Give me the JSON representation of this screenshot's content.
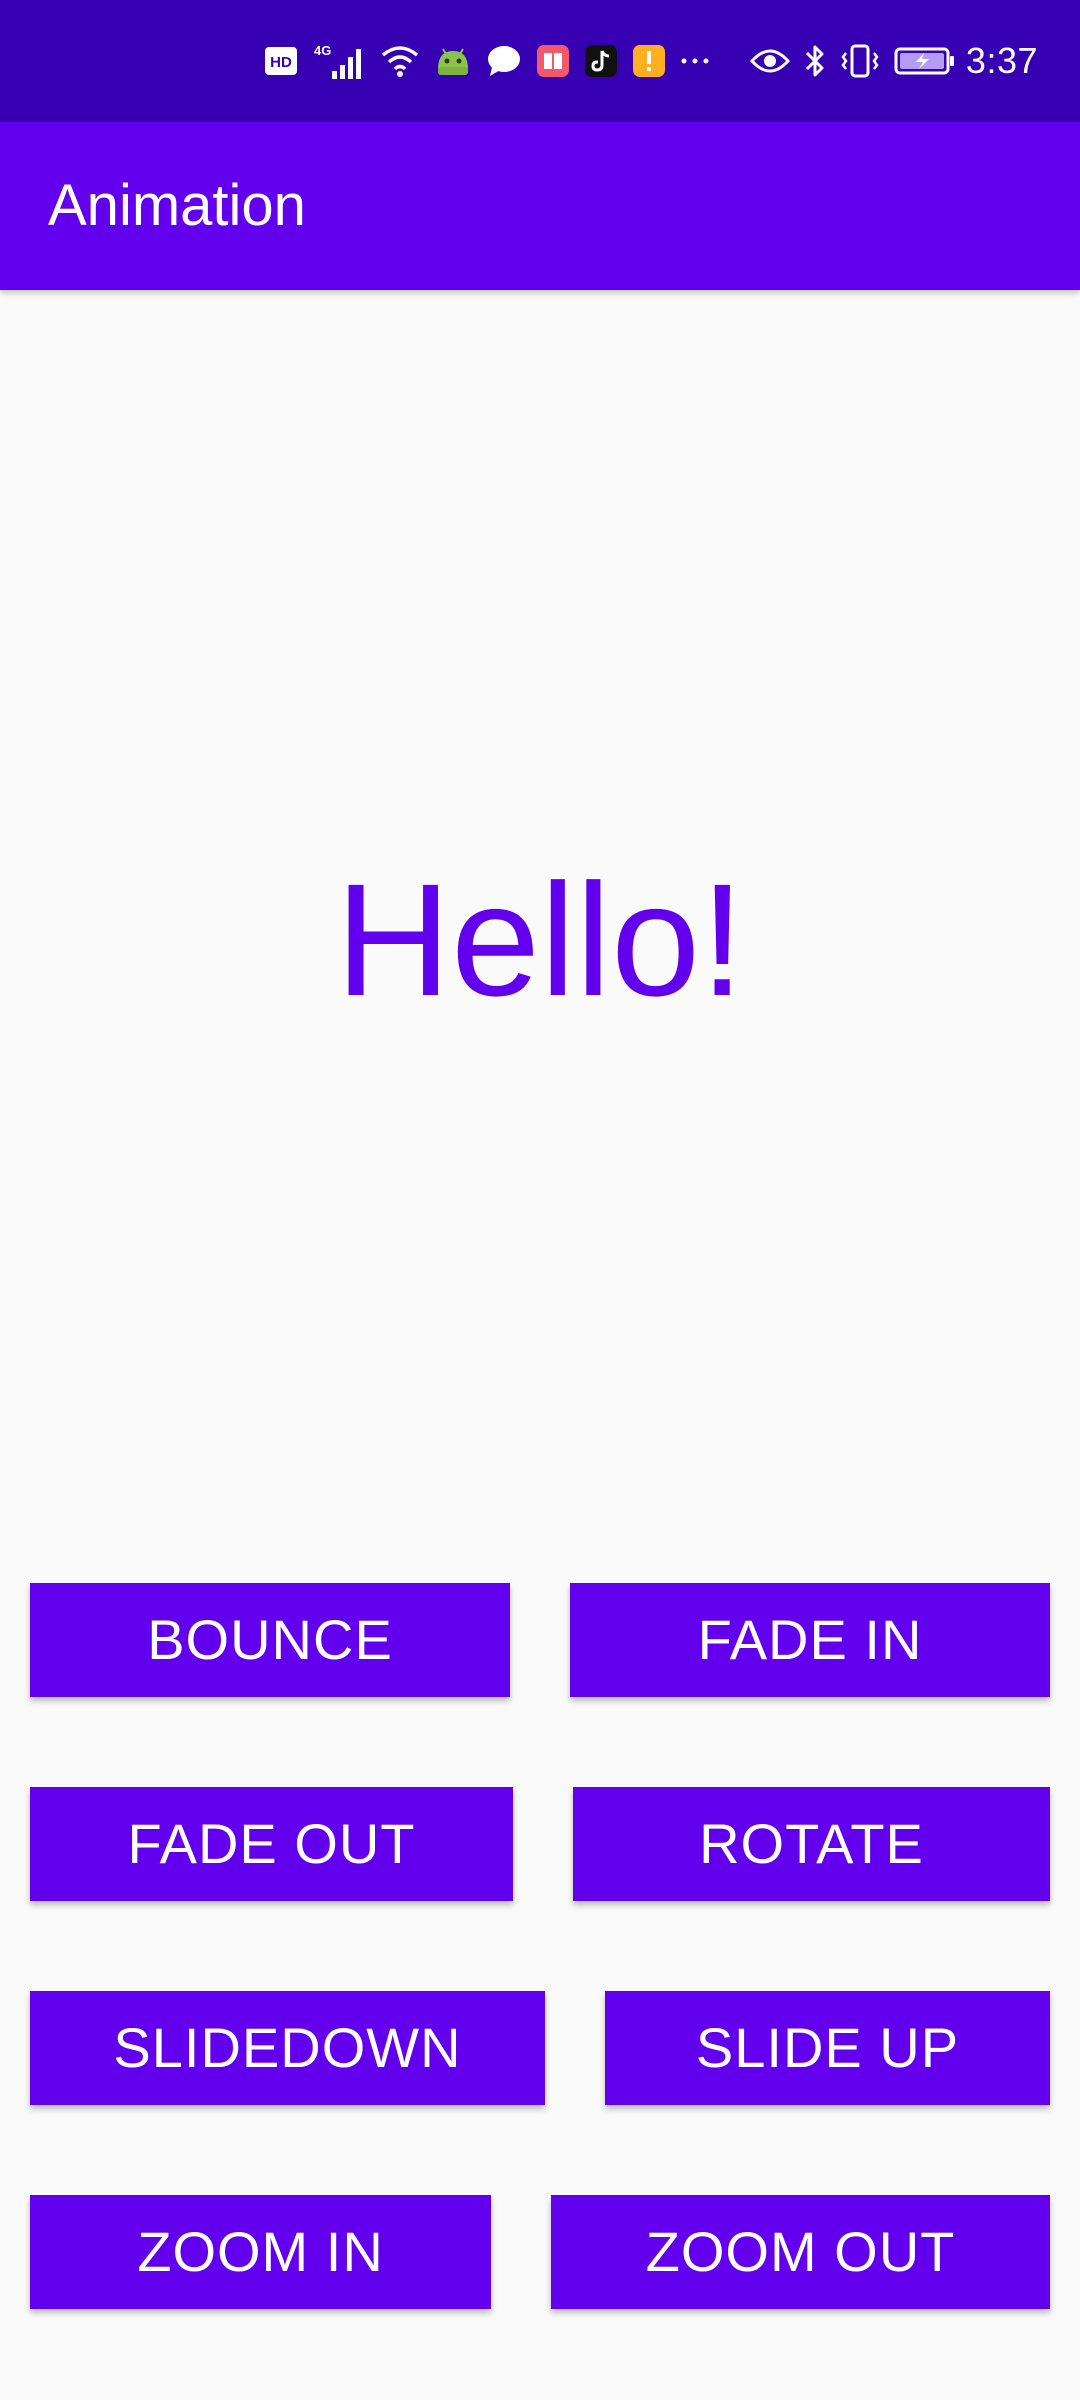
{
  "status_bar": {
    "time": "3:37",
    "icons": [
      "hd-icon",
      "signal-4g-icon",
      "wifi-icon",
      "android-icon",
      "chat-bubble-icon",
      "book-app-icon",
      "tiktok-icon",
      "warning-app-icon",
      "more-dots-icon",
      "eye-icon",
      "bluetooth-icon",
      "vibrate-icon",
      "battery-charging-icon"
    ],
    "signal_label": "4G",
    "hd_label": "HD",
    "more_label": "···",
    "colors": {
      "background": "#3700B3"
    }
  },
  "app_bar": {
    "title": "Animation",
    "color": "#6200EE"
  },
  "main": {
    "hello_text": "Hello!",
    "text_color": "#6200EE"
  },
  "buttons": {
    "bounce": "BOUNCE",
    "fade_in": "FADE IN",
    "fade_out": "FADE OUT",
    "rotate": "ROTATE",
    "slidedown": "SLIDEDOWN",
    "slide_up": "SLIDE UP",
    "zoom_in": "ZOOM IN",
    "zoom_out": "ZOOM OUT",
    "color": "#6200EE"
  }
}
